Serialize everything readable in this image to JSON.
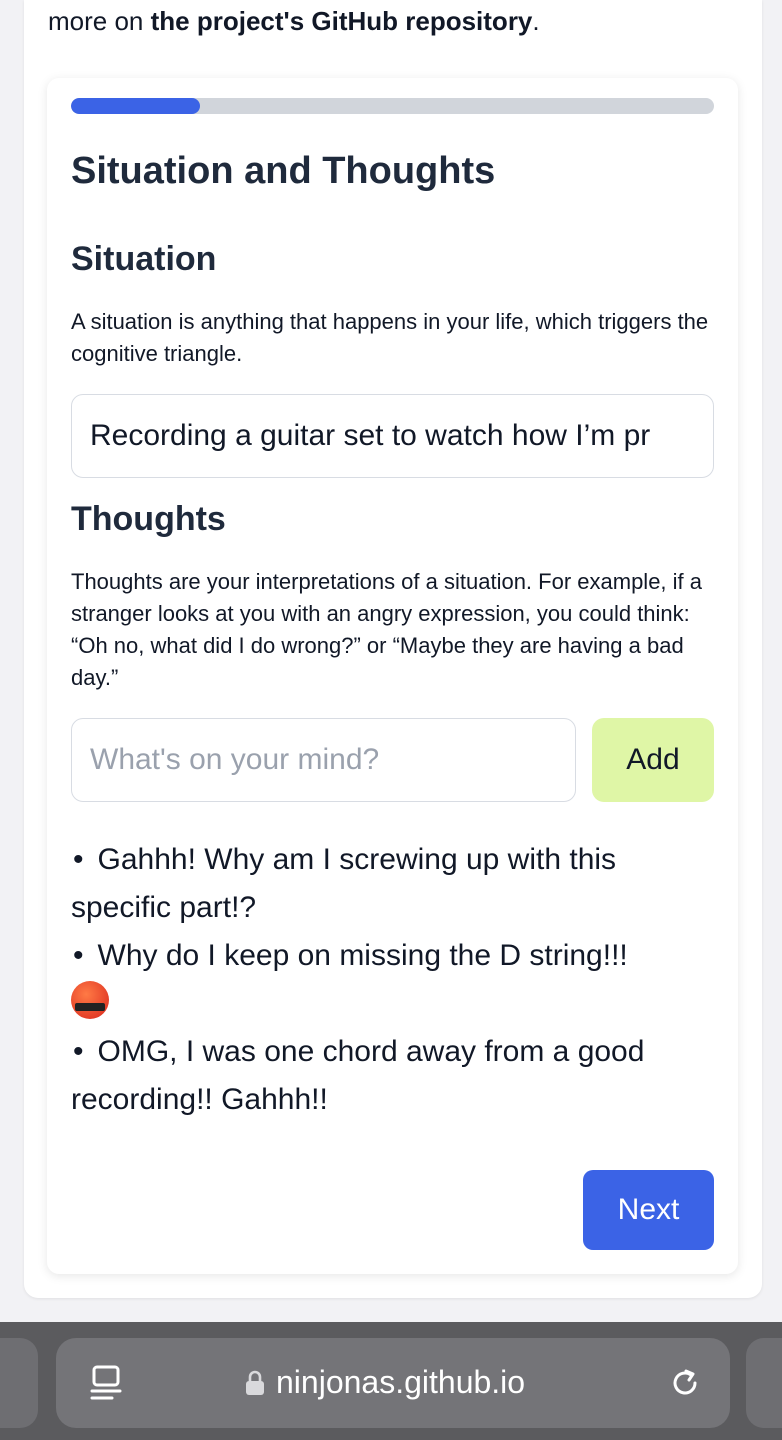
{
  "intro": {
    "prefix": "more on ",
    "link": "the project's GitHub repository",
    "suffix": "."
  },
  "progress": {
    "fraction": 0.2
  },
  "page_title": "Situation and Thoughts",
  "situation": {
    "heading": "Situation",
    "description": "A situation is anything that happens in your life, which triggers the cognitive triangle.",
    "value": "Recording a guitar set to watch how I’m pr"
  },
  "thoughts": {
    "heading": "Thoughts",
    "description": "Thoughts are your interpretations of a situation. For example, if a stranger looks at you with an angry expression, you could think: “Oh no, what did I do wrong?” or “Maybe they are having a bad day.”",
    "input_placeholder": "What's on your mind?",
    "add_label": "Add",
    "items": [
      "Gahhh! Why am I screwing up with this specific part!?",
      "Why do I keep on missing the D string!!!",
      "OMG, I was one chord away from a good recording!! Gahhh!!"
    ]
  },
  "next_label": "Next",
  "browser": {
    "url": "ninjonas.github.io"
  },
  "colors": {
    "accent": "#3b63e6",
    "add_button": "#dff6a6",
    "progress_track": "#d1d5db"
  },
  "icons": [
    "reader-icon",
    "lock-icon",
    "reload-icon",
    "angry-emoji-icon"
  ]
}
